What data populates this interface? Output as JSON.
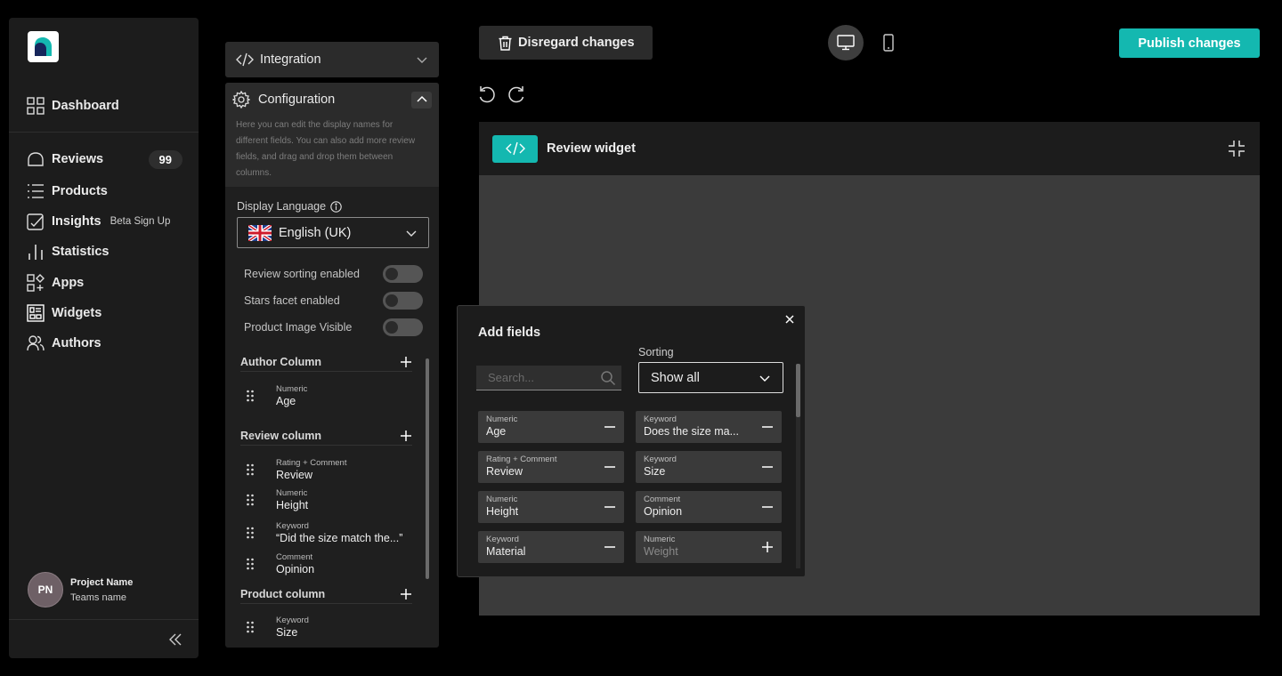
{
  "sidebar": {
    "nav": [
      {
        "label": "Dashboard",
        "icon": "dashboard-grid-icon"
      },
      {
        "label": "Reviews",
        "icon": "cloud-icon",
        "badge": "99"
      },
      {
        "label": "Products",
        "icon": "list-icon"
      },
      {
        "label": "Insights",
        "icon": "insights-icon",
        "tag": "Beta Sign Up"
      },
      {
        "label": "Statistics",
        "icon": "bar-chart-icon"
      },
      {
        "label": "Apps",
        "icon": "apps-icon"
      },
      {
        "label": "Widgets",
        "icon": "widgets-icon"
      },
      {
        "label": "Authors",
        "icon": "users-icon"
      }
    ],
    "profile": {
      "initials": "PN",
      "name": "Project Name",
      "team": "Teams name"
    }
  },
  "panel": {
    "integration": "Integration",
    "configuration": "Configuration",
    "description": "Here you can edit the display names for different fields. You can also add more review fields, and drag and drop them between columns.",
    "language_label": "Display Language",
    "language_value": "English (UK)",
    "toggles": [
      {
        "label": "Review sorting enabled",
        "on": false
      },
      {
        "label": "Stars facet enabled",
        "on": false
      },
      {
        "label": "Product Image Visible",
        "on": false
      }
    ],
    "columns": [
      {
        "title": "Author Column",
        "fields": [
          {
            "type": "Numeric",
            "name": "Age"
          }
        ]
      },
      {
        "title": "Review column",
        "fields": [
          {
            "type": "Rating + Comment",
            "name": "Review"
          },
          {
            "type": "Numeric",
            "name": "Height"
          },
          {
            "type": "Keyword",
            "name": "“Did the size match the...”"
          },
          {
            "type": "Comment",
            "name": "Opinion"
          }
        ]
      },
      {
        "title": "Product column",
        "fields": [
          {
            "type": "Keyword",
            "name": "Size"
          }
        ]
      }
    ]
  },
  "toolbar": {
    "disregard": "Disregard changes",
    "publish": "Publish changes"
  },
  "preview": {
    "title": "Review widget"
  },
  "modal": {
    "title": "Add fields",
    "search_placeholder": "Search...",
    "sorting_label": "Sorting",
    "sorting_value": "Show all",
    "fields": [
      {
        "type": "Numeric",
        "name": "Age",
        "action": "remove"
      },
      {
        "type": "Keyword",
        "name": "Does the size ma...",
        "action": "remove"
      },
      {
        "type": "Rating + Comment",
        "name": "Review",
        "action": "remove"
      },
      {
        "type": "Keyword",
        "name": "Size",
        "action": "remove"
      },
      {
        "type": "Numeric",
        "name": "Height",
        "action": "remove"
      },
      {
        "type": "Comment",
        "name": "Opinion",
        "action": "remove"
      },
      {
        "type": "Keyword",
        "name": "Material",
        "action": "remove"
      },
      {
        "type": "Numeric",
        "name": "Weight",
        "action": "add"
      }
    ]
  },
  "colors": {
    "accent": "#14b8b0",
    "background": "#000000",
    "panel": "#1c1c1c"
  }
}
